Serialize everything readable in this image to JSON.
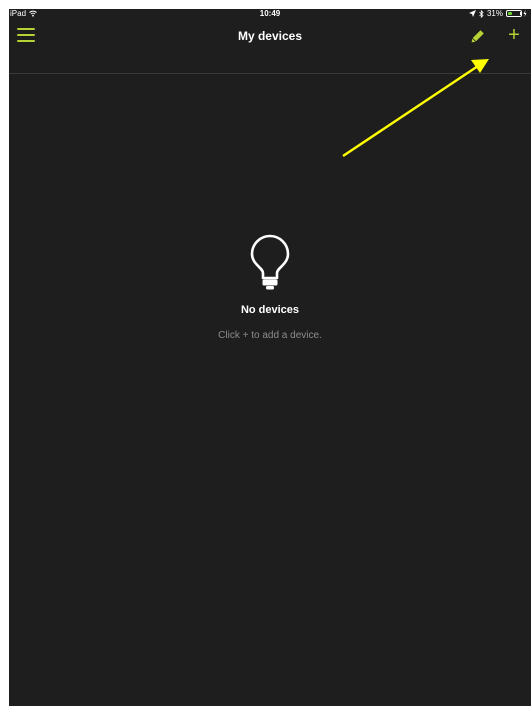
{
  "status_bar": {
    "device": "iPad",
    "time": "10:49",
    "battery": "31%",
    "battery_level": 0.31
  },
  "nav": {
    "title": "My devices",
    "menu_icon": "hamburger-menu-icon",
    "edit_icon": "pencil-icon",
    "add_icon": "plus-icon",
    "add_label": "+"
  },
  "empty_state": {
    "icon": "lightbulb-icon",
    "title": "No devices",
    "subtitle": "Click + to add a device."
  },
  "colors": {
    "accent": "#b5d334",
    "background": "#1e1e1e",
    "annotation_arrow": "#ffff00"
  }
}
